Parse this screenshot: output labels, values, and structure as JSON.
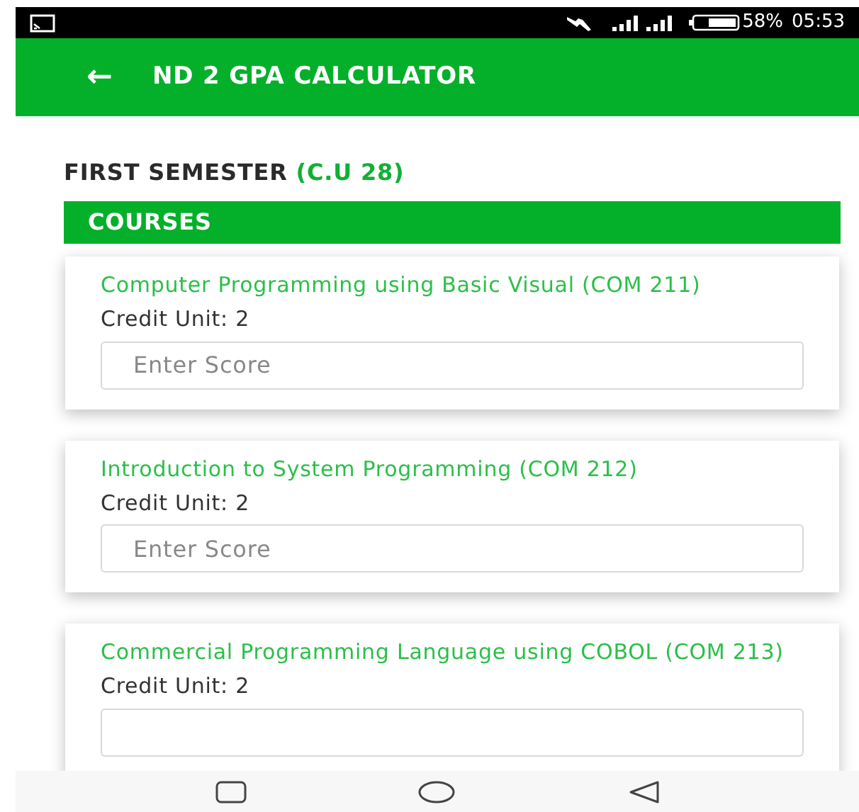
{
  "status_bar": {
    "battery": "58%",
    "time": "05:53"
  },
  "app_bar": {
    "back": "←",
    "title": "ND 2 GPA CALCULATOR"
  },
  "semester": {
    "title": "FIRST SEMESTER",
    "units": "(C.U 28)"
  },
  "section": {
    "title": "COURSES"
  },
  "courses": [
    {
      "title": "Computer Programming using Basic Visual (COM 211)",
      "credit": "Credit Unit: 2",
      "placeholder": "Enter Score"
    },
    {
      "title": "Introduction to System Programming (COM 212)",
      "credit": "Credit Unit: 2",
      "placeholder": "Enter Score"
    },
    {
      "title": "Commercial Programming Language using COBOL (COM 213)",
      "credit": "Credit Unit: 2"
    }
  ]
}
